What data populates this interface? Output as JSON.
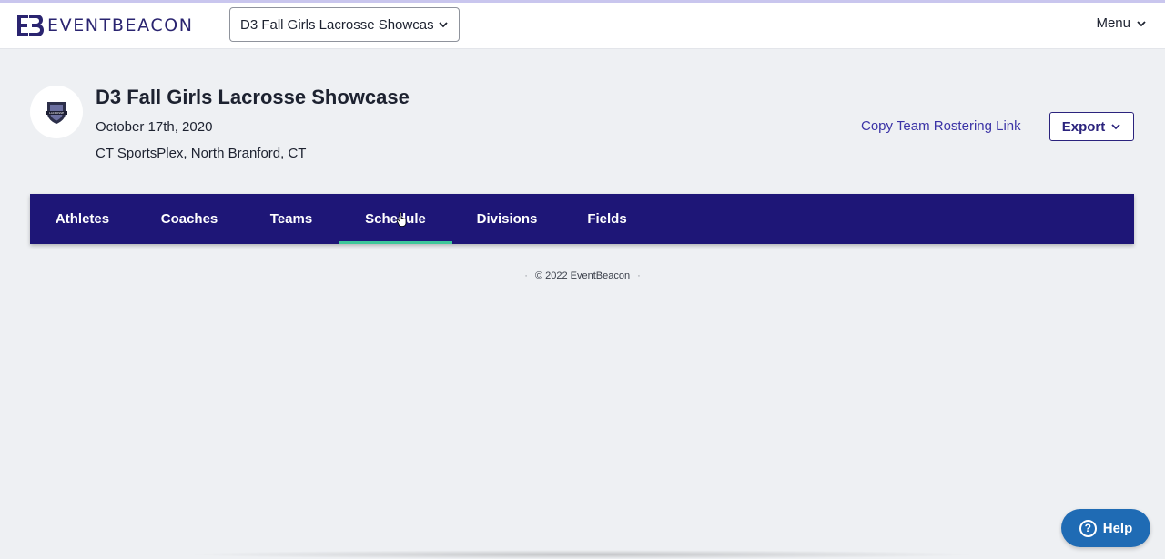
{
  "colors": {
    "brand": "#2a2470",
    "nav_background": "#1e1677",
    "active_tab_underline": "#3ec79a",
    "link": "#3b33a6",
    "help_button": "#1f6bb4",
    "page_background": "#eef0f3"
  },
  "header": {
    "logo_text": "EVENTBEACON",
    "event_selector": {
      "value": "D3 Fall Girls Lacrosse Showcase"
    },
    "menu_label": "Menu"
  },
  "event": {
    "title": "D3 Fall Girls Lacrosse Showcase",
    "date": "October 17th, 2020",
    "location": "CT SportsPlex, North Branford, CT"
  },
  "actions": {
    "copy_link_label": "Copy Team Rostering Link",
    "export_label": "Export"
  },
  "tabs": [
    {
      "label": "Athletes",
      "active": false
    },
    {
      "label": "Coaches",
      "active": false
    },
    {
      "label": "Teams",
      "active": false
    },
    {
      "label": "Schedule",
      "active": true
    },
    {
      "label": "Divisions",
      "active": false
    },
    {
      "label": "Fields",
      "active": false
    }
  ],
  "footer": {
    "copyright": "© 2022 EventBeacon"
  },
  "help": {
    "label": "Help",
    "icon": "question-icon"
  }
}
